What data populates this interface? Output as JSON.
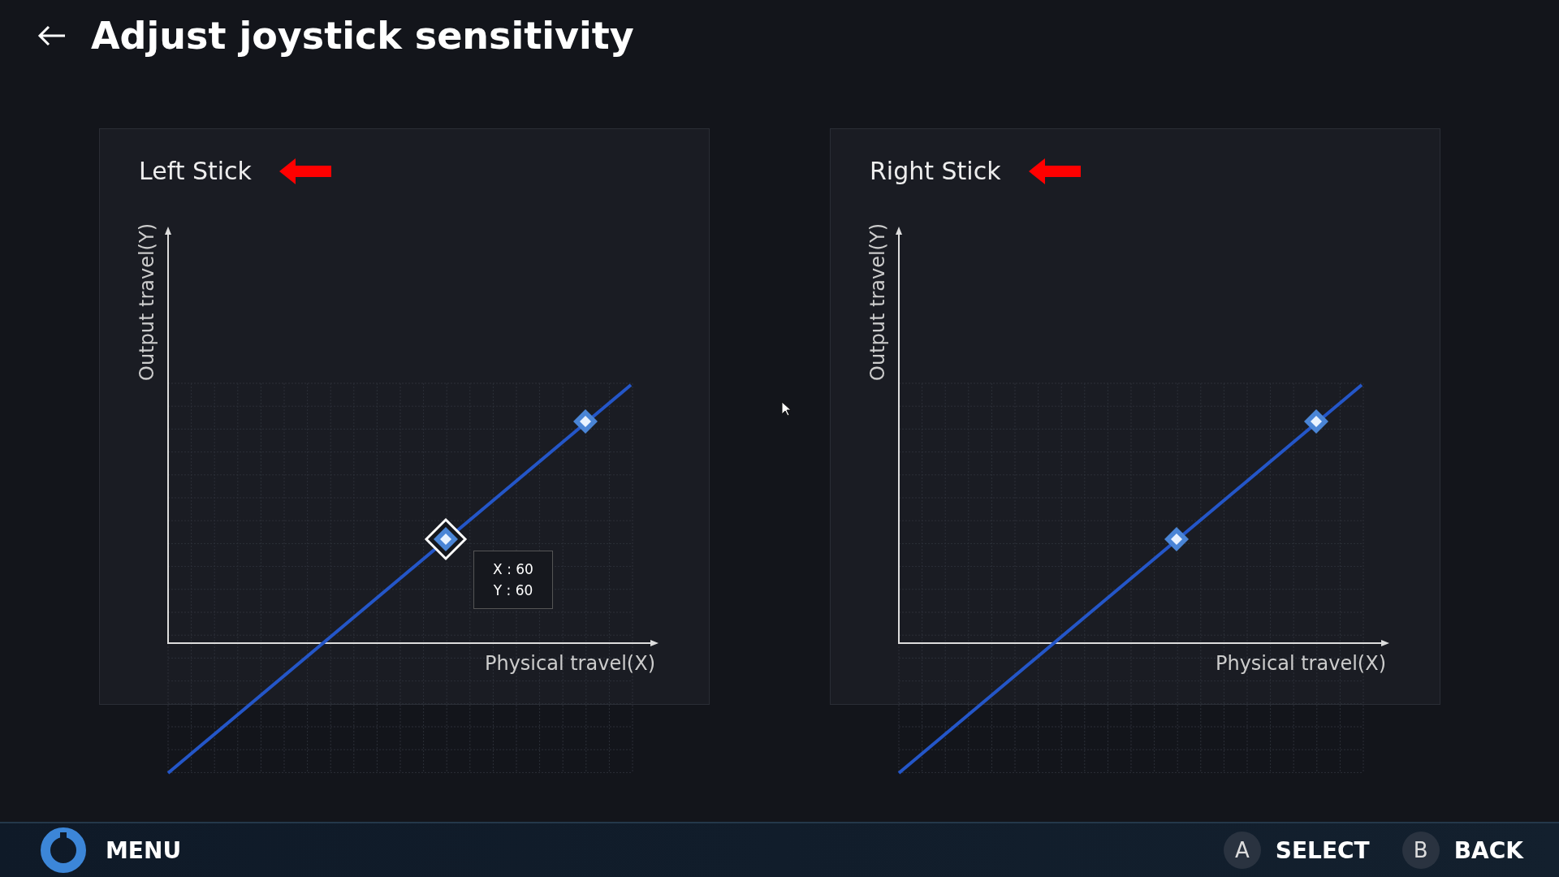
{
  "header": {
    "title": "Adjust joystick sensitivity"
  },
  "panels": [
    {
      "title": "Left Stick",
      "y_label": "Output travel(Y)",
      "x_label": "Physical travel(X)",
      "handles": [
        {
          "selected": true
        },
        {
          "selected": false
        }
      ],
      "tooltip": [
        "X : 60",
        "Y : 60"
      ]
    },
    {
      "title": "Right Stick",
      "y_label": "Output travel(Y)",
      "x_label": "Physical travel(X)",
      "handles": [
        {
          "selected": false
        },
        {
          "selected": false
        }
      ]
    }
  ],
  "footer": {
    "menu": "MENU",
    "hints": [
      {
        "key": "A",
        "label": "SELECT"
      },
      {
        "key": "B",
        "label": "BACK"
      }
    ]
  }
}
